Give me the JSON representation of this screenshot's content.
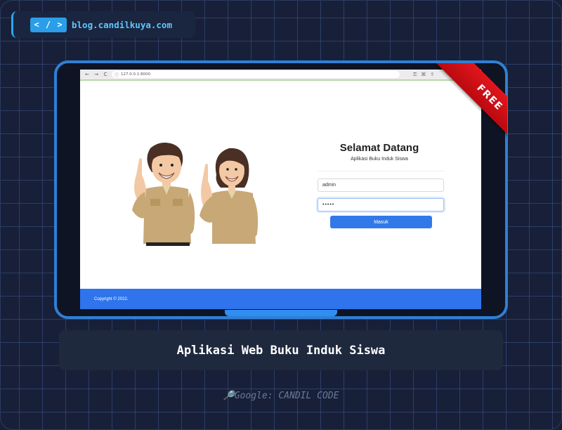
{
  "badge": {
    "icon": "code-icon",
    "icon_text": "< / >",
    "url": "blog.candilkuya.com"
  },
  "browser": {
    "address": "127.0.0.1:8000",
    "back": "←",
    "forward": "→",
    "reload": "C"
  },
  "ribbon": {
    "label": "FREE",
    "color": "#d0121a"
  },
  "login": {
    "title": "Selamat Datang",
    "subtitle": "Aplikasi Buku Induk Siswa",
    "username_value": "admin",
    "password_value": "•••••",
    "submit_label": "Masuk"
  },
  "footer": {
    "copyright": "Copyright © 2022."
  },
  "caption": {
    "title": "Aplikasi Web Buku Induk Siswa"
  },
  "google": {
    "text": "🔎Google: CANDIL CODE"
  },
  "colors": {
    "accent": "#2f74ec",
    "background": "#172038",
    "device_border": "#2f7fd6"
  }
}
